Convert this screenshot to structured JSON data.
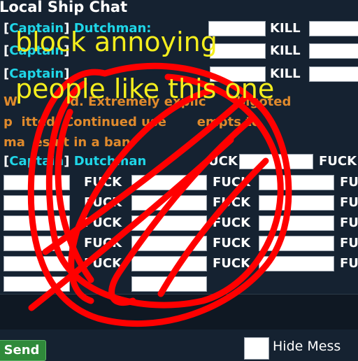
{
  "chat": {
    "title": "Local Ship Chat",
    "tag_open": "[",
    "tag": "Captain",
    "tag_close": "]",
    "name": "Dutchman:",
    "name2": "Dutchman",
    "kill": "KILL",
    "warning_1": "W",
    "warning_2": "d. Extremely explic",
    "warning_3": "bigoted",
    "warning_4": "p",
    "warning_5": "itted. Continued use",
    "warning_6": "empts to",
    "warning_7": "ma",
    "warning_8": "esult in a ban.",
    "spam_fragment": "UCK",
    "spam_word": "FUCK",
    "spam_word_cut": "FU",
    "spam_word_cut2": "FU",
    "spam_tail": "CK"
  },
  "footer": {
    "send_label": "Send",
    "hide_label": "Hide Mess"
  },
  "annotation": {
    "line1": "block annoying",
    "line2": "people like this one",
    "color": "#f4ee1d",
    "scribble_color": "#ff0000"
  }
}
